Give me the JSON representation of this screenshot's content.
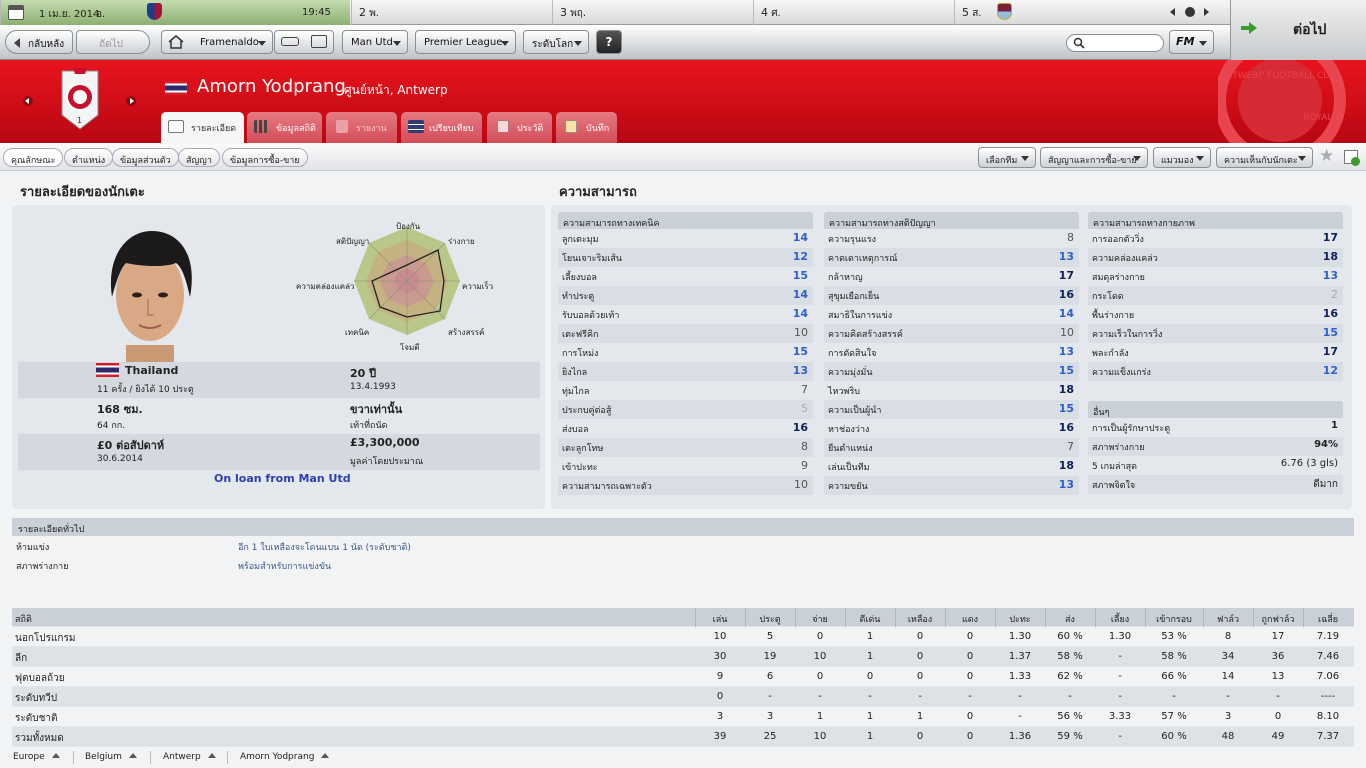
{
  "calendar": {
    "today_date": "1 เม.ย. 2014",
    "today_weekday": "อ.",
    "time": "19:45",
    "days": [
      {
        "num": "2",
        "wd": "พ."
      },
      {
        "num": "3",
        "wd": "พฤ."
      },
      {
        "num": "4",
        "wd": "ศ."
      },
      {
        "num": "5",
        "wd": "ส."
      }
    ]
  },
  "toolbar": {
    "back": "กลับหลัง",
    "forward": "ถัดไป",
    "manager": "Framenaldo",
    "club": "Man Utd",
    "league": "Premier League",
    "world": "ระดับโลก",
    "help": "?",
    "search_placeholder": "",
    "fm": "FM",
    "continue": "ต่อไป"
  },
  "header": {
    "player_name": "Amorn Yodprang",
    "position_club": "ศูนย์หน้า, Antwerp",
    "squad_number": "1",
    "crest_text": "ANTWERP FOOTBALL CLUB",
    "crest_text_2": "ROYAL",
    "tabs": [
      {
        "label": "รายละเอียด"
      },
      {
        "label": "ข้อมูลสถิติ"
      },
      {
        "label": "รายงาน"
      },
      {
        "label": "เปรียบเทียบ"
      },
      {
        "label": "ประวัติ"
      },
      {
        "label": "บันทึก"
      }
    ]
  },
  "subbar": {
    "pills": [
      "คุณลักษณะ",
      "ตำแหน่ง",
      "ข้อมูลส่วนตัว",
      "สัญญา",
      "ข้อมูลการซื้อ-ขาย"
    ],
    "dropdowns": [
      "เลือกทีม",
      "สัญญาและการซื้อ-ขาย",
      "แมวมอง",
      "ความเห็นกับนักเตะ"
    ]
  },
  "player_details": {
    "title": "รายละเอียดของนักเตะ",
    "nationality": "Thailand",
    "caps": "11 ครั้ง / ยิงได้ 10 ประตู",
    "age": "20 ปี",
    "dob": "13.4.1993",
    "height": "168 ซม.",
    "weight": "64 กก.",
    "foot": "ขวาเท่านั้น",
    "foot_label": "เท้าที่ถนัด",
    "wage": "£0 ต่อสัปดาห์",
    "contract_end": "30.6.2014",
    "value": "£3,300,000",
    "value_label": "มูลค่าโดยประมาณ",
    "loan": "On loan from Man Utd",
    "radar_labels": [
      "ป้องกัน",
      "ร่างกาย",
      "ความเร็ว",
      "สร้างสรรค์",
      "โจมตี",
      "เทคนิค",
      "ความคล่องแคล่ว",
      "สติปัญญา"
    ]
  },
  "abilities": {
    "title": "ความสามารถ",
    "technical": {
      "title": "ความสามารถทางเทคนิค",
      "rows": [
        {
          "label": "ลูกเตะมุม",
          "value": "14"
        },
        {
          "label": "โยนเจาะริมเส้น",
          "value": "12"
        },
        {
          "label": "เลี้ยงบอล",
          "value": "15"
        },
        {
          "label": "ทำประตู",
          "value": "14"
        },
        {
          "label": "รับบอลด้วยเท้า",
          "value": "14"
        },
        {
          "label": "เตะฟรีคิก",
          "value": "10"
        },
        {
          "label": "การโหม่ง",
          "value": "15"
        },
        {
          "label": "ยิงไกล",
          "value": "13"
        },
        {
          "label": "ทุ่มไกล",
          "value": "7"
        },
        {
          "label": "ประกบคู่ต่อสู้",
          "value": "5"
        },
        {
          "label": "ส่งบอล",
          "value": "16"
        },
        {
          "label": "เตะลูกโทษ",
          "value": "8"
        },
        {
          "label": "เข้าปะทะ",
          "value": "9"
        },
        {
          "label": "ความสามารถเฉพาะตัว",
          "value": "10"
        }
      ]
    },
    "mental": {
      "title": "ความสามารถทางสติปัญญา",
      "rows": [
        {
          "label": "ความรุนแรง",
          "value": "8"
        },
        {
          "label": "คาดเดาเหตุการณ์",
          "value": "13"
        },
        {
          "label": "กล้าหาญ",
          "value": "17"
        },
        {
          "label": "สุขุมเยือกเย็น",
          "value": "16"
        },
        {
          "label": "สมาธิในการแข่ง",
          "value": "14"
        },
        {
          "label": "ความคิดสร้างสรรค์",
          "value": "10"
        },
        {
          "label": "การตัดสินใจ",
          "value": "13"
        },
        {
          "label": "ความมุ่งมั่น",
          "value": "15"
        },
        {
          "label": "ไหวพริบ",
          "value": "18"
        },
        {
          "label": "ความเป็นผู้นำ",
          "value": "15"
        },
        {
          "label": "หาช่องว่าง",
          "value": "16"
        },
        {
          "label": "ยืนตำแหน่ง",
          "value": "7"
        },
        {
          "label": "เล่นเป็นทีม",
          "value": "18"
        },
        {
          "label": "ความขยัน",
          "value": "13"
        }
      ]
    },
    "physical": {
      "title": "ความสามารถทางกายภาพ",
      "rows": [
        {
          "label": "การออกตัววิ่ง",
          "value": "17"
        },
        {
          "label": "ความคล่องแคล่ว",
          "value": "18"
        },
        {
          "label": "สมดุลร่างกาย",
          "value": "13"
        },
        {
          "label": "กระโดด",
          "value": "2"
        },
        {
          "label": "พื้นร่างกาย",
          "value": "16"
        },
        {
          "label": "ความเร็วในการวิ่ง",
          "value": "15"
        },
        {
          "label": "พละกำลัง",
          "value": "17"
        },
        {
          "label": "ความแข็งแกร่ง",
          "value": "12"
        }
      ]
    },
    "other": {
      "title": "อื่นๆ",
      "rows": [
        {
          "label": "การเป็นผู้รักษาประตู",
          "value": "1"
        },
        {
          "label": "สภาพร่างกาย",
          "value": "94%"
        },
        {
          "label": "5 เกมล่าสุด",
          "value": "6.76 (3 gls)"
        },
        {
          "label": "สภาพจิตใจ",
          "value": "ดีมาก"
        }
      ]
    }
  },
  "general": {
    "title": "รายละเอียดทั่วไป",
    "rows": [
      {
        "label": "ห้ามแข่ง",
        "value": "อีก 1 ใบเหลืองจะโดนแบน 1 นัด (ระดับชาติ)"
      },
      {
        "label": "สภาพร่างกาย",
        "value": "พร้อมสำหรับการแข่งขัน"
      }
    ]
  },
  "stats": {
    "headers": [
      "สถิติ",
      "เล่น",
      "ประตู",
      "จ่าย",
      "ดีเด่น",
      "เหลือง",
      "แดง",
      "ปะทะ",
      "ส่ง",
      "เลี้ยง",
      "เข้ากรอบ",
      "ฟาล์ว",
      "ถูกฟาล์ว",
      "เฉลี่ย"
    ],
    "rows": [
      [
        "นอกโปรแกรม",
        "10",
        "5",
        "0",
        "1",
        "0",
        "0",
        "1.30",
        "60 %",
        "1.30",
        "53 %",
        "8",
        "17",
        "7.19"
      ],
      [
        "ลีก",
        "30",
        "19",
        "10",
        "1",
        "0",
        "0",
        "1.37",
        "58 %",
        "-",
        "58 %",
        "34",
        "36",
        "7.46"
      ],
      [
        "ฟุตบอลถ้วย",
        "9",
        "6",
        "0",
        "0",
        "0",
        "0",
        "1.33",
        "62 %",
        "-",
        "66 %",
        "14",
        "13",
        "7.06"
      ],
      [
        "ระดับทวีป",
        "0",
        "-",
        "-",
        "-",
        "-",
        "-",
        "-",
        "-",
        "-",
        "-",
        "-",
        "-",
        "----"
      ],
      [
        "ระดับชาติ",
        "3",
        "3",
        "1",
        "1",
        "1",
        "0",
        "-",
        "56 %",
        "3.33",
        "57 %",
        "3",
        "0",
        "8.10"
      ],
      [
        "รวมทั้งหมด",
        "39",
        "25",
        "10",
        "1",
        "0",
        "0",
        "1.36",
        "59 %",
        "-",
        "60 %",
        "48",
        "49",
        "7.37"
      ]
    ]
  },
  "breadcrumb": [
    "Europe",
    "Belgium",
    "Antwerp",
    "Amorn Yodprang"
  ],
  "colors": {
    "header_red": "#d20d18",
    "value_blue": "#1f3f9f",
    "loan_blue": "#2b3fb0"
  }
}
